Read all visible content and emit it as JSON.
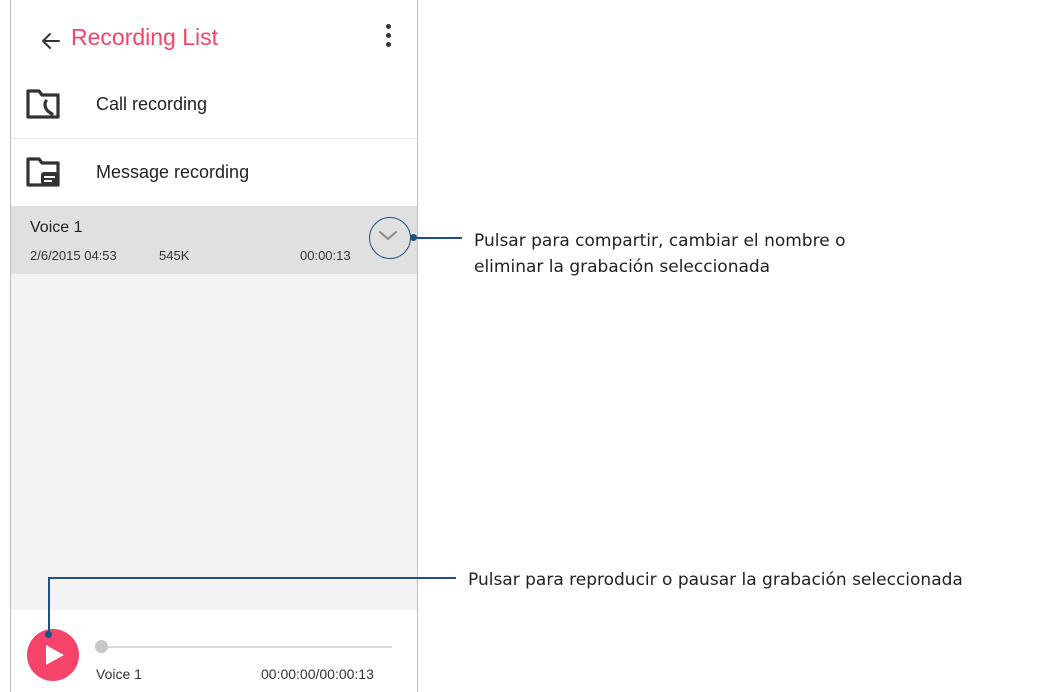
{
  "header": {
    "title": "Recording List",
    "back_icon": "arrow-left-icon",
    "menu_icon": "more-vert-icon",
    "title_color": "#f5436a"
  },
  "folders": [
    {
      "label": "Call recording",
      "icon": "folder-call-icon"
    },
    {
      "label": "Message recording",
      "icon": "folder-message-icon"
    }
  ],
  "recordings": [
    {
      "name": "Voice 1",
      "date": "2/6/2015 04:53",
      "size": "545K",
      "duration": "00:00:13",
      "action_icon": "chevron-down-icon"
    }
  ],
  "player": {
    "track_name": "Voice 1",
    "time": "00:00:00/00:00:13",
    "progress": 0.0,
    "play_icon": "play-icon",
    "accent_color": "#f5436a"
  },
  "annotations": {
    "expand_line1": "Pulsar para compartir, cambiar el nombre o",
    "expand_line2": "eliminar la grabación seleccionada",
    "play": "Pulsar para reproducir o pausar la grabación seleccionada",
    "line_color": "#1f4f86"
  }
}
